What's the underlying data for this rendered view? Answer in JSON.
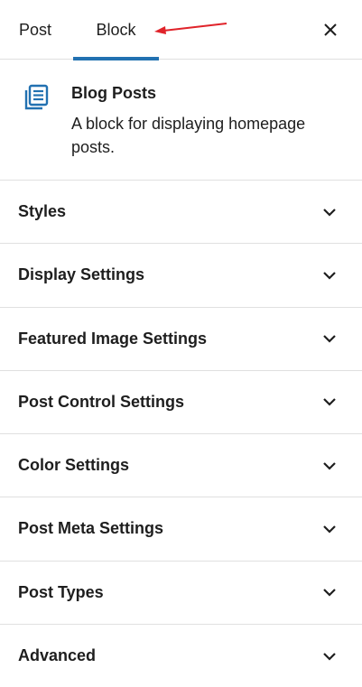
{
  "tabs": {
    "post_label": "Post",
    "block_label": "Block"
  },
  "block": {
    "title": "Blog Posts",
    "description": "A block for displaying homepage posts.",
    "icon": "blog-posts-icon"
  },
  "sections": [
    {
      "label": "Styles"
    },
    {
      "label": "Display Settings"
    },
    {
      "label": "Featured Image Settings"
    },
    {
      "label": "Post Control Settings"
    },
    {
      "label": "Color Settings"
    },
    {
      "label": "Post Meta Settings"
    },
    {
      "label": "Post Types"
    },
    {
      "label": "Advanced"
    }
  ],
  "colors": {
    "active_tab_underline": "#2271b1",
    "block_icon": "#2271b1",
    "annotation_arrow": "#e0232a",
    "divider": "#e0e0e0"
  }
}
